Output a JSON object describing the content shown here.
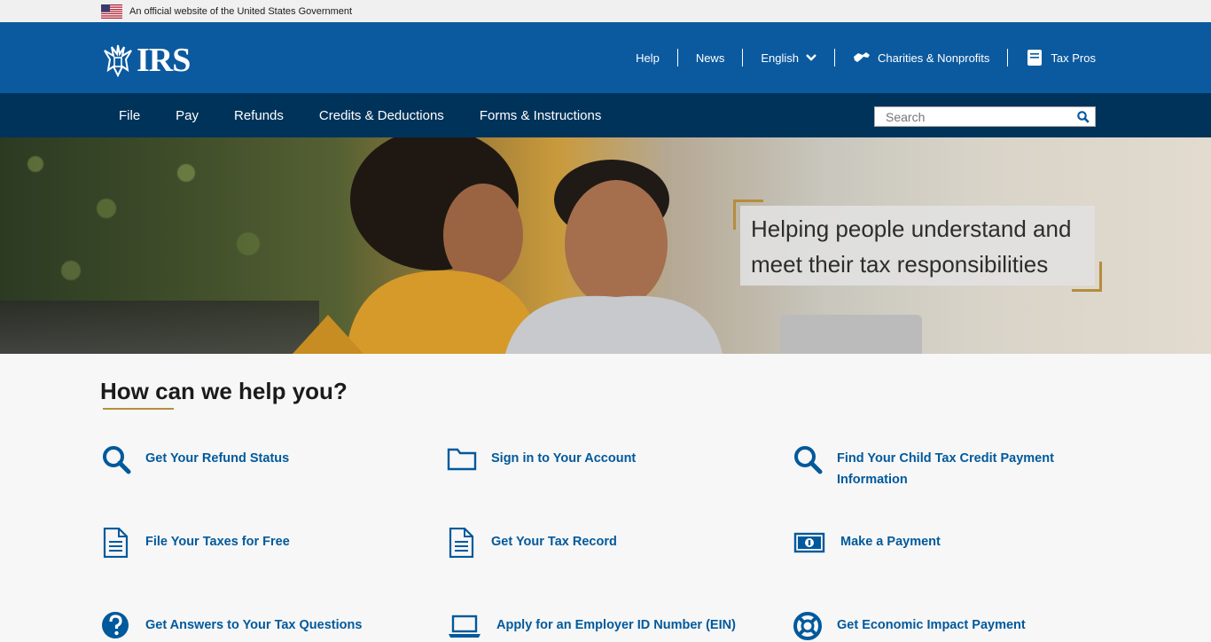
{
  "gov_banner": {
    "text": "An official website of the United States Government"
  },
  "header": {
    "logo_text": "IRS",
    "util_nav": [
      {
        "label": "Help"
      },
      {
        "label": "News"
      },
      {
        "label": "English"
      },
      {
        "label": "Charities & Nonprofits"
      },
      {
        "label": "Tax Pros"
      }
    ]
  },
  "main_nav": {
    "items": [
      {
        "label": "File"
      },
      {
        "label": "Pay"
      },
      {
        "label": "Refunds"
      },
      {
        "label": "Credits & Deductions"
      },
      {
        "label": "Forms & Instructions"
      }
    ],
    "search_placeholder": "Search"
  },
  "hero": {
    "line1": "Helping people understand and",
    "line2": "meet their tax responsibilities"
  },
  "help": {
    "title": "How can we help you?",
    "tasks": [
      {
        "label": "Get Your Refund Status",
        "icon": "search-icon"
      },
      {
        "label": "Sign in to Your Account",
        "icon": "folder-icon"
      },
      {
        "label": "Find Your Child Tax Credit Payment",
        "label2": "Information",
        "icon": "search-icon"
      },
      {
        "label": "File Your Taxes for Free",
        "icon": "document-icon"
      },
      {
        "label": "Get Your Tax Record",
        "icon": "document-icon"
      },
      {
        "label": "Make a Payment",
        "icon": "money-icon"
      },
      {
        "label": "Get Answers to Your Tax Questions",
        "icon": "question-icon"
      },
      {
        "label": "Apply for an Employer ID Number (EIN)",
        "icon": "laptop-icon"
      },
      {
        "label": "Get Economic Impact Payment",
        "icon": "lifebuoy-icon"
      }
    ]
  },
  "colors": {
    "header_blue": "#0b5aa0",
    "nav_navy": "#00335a",
    "link_blue": "#00599c",
    "accent_gold": "#b58d3d"
  }
}
